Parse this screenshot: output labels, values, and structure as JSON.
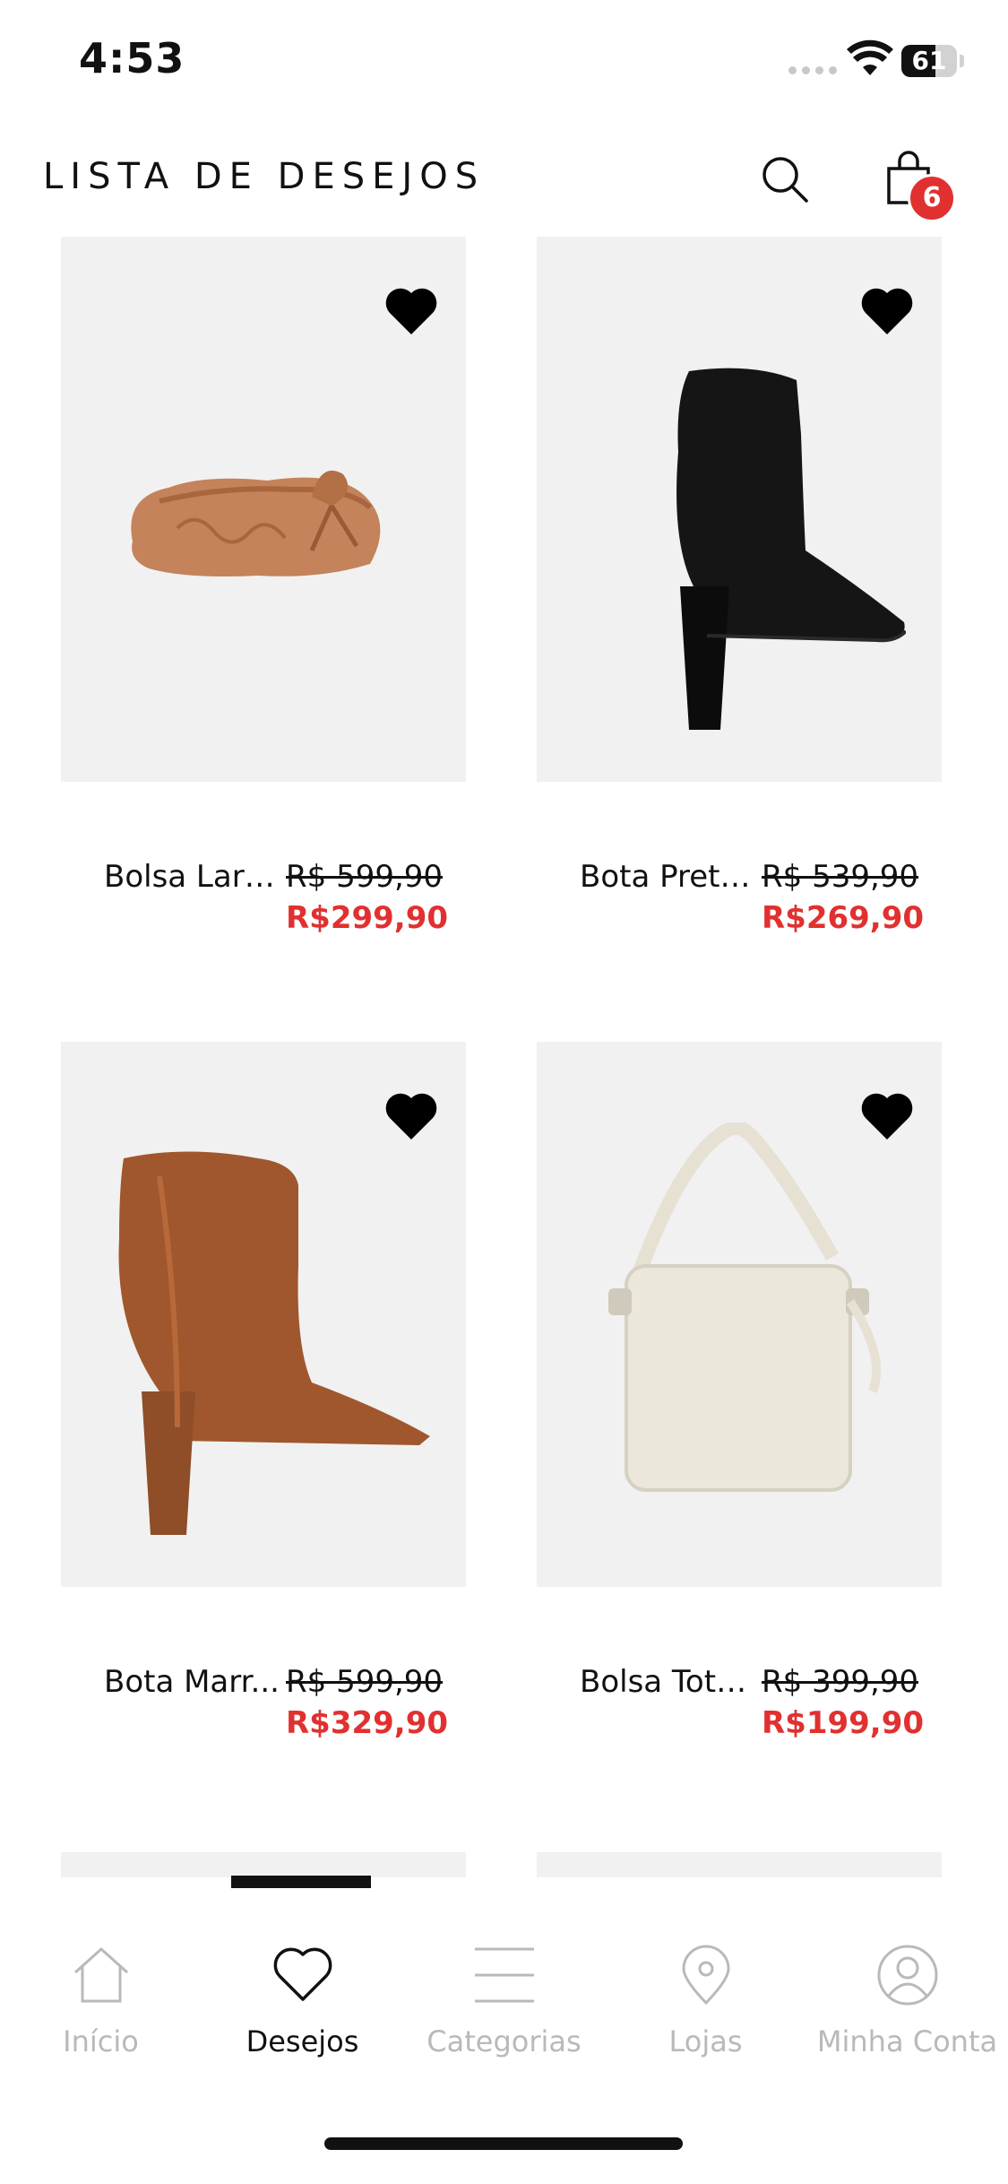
{
  "status": {
    "time": "4:53",
    "battery": "61",
    "battery_level": 0.61
  },
  "header": {
    "title": "LISTA DE DESEJOS",
    "cart_count": "6"
  },
  "products": [
    {
      "name": "Bolsa Lara...",
      "old_price": "R$ 599,90",
      "price": "R$299,90",
      "icon": "clutch-bag-image",
      "favorite": true
    },
    {
      "name": "Bota Preta...",
      "old_price": "R$ 539,90",
      "price": "R$269,90",
      "icon": "black-boot-image",
      "favorite": true
    },
    {
      "name": "Bota Marr...",
      "old_price": "R$ 599,90",
      "price": "R$329,90",
      "icon": "brown-boot-image",
      "favorite": true
    },
    {
      "name": "Bolsa Tote...",
      "old_price": "R$ 399,90",
      "price": "R$199,90",
      "icon": "tote-bag-image",
      "favorite": true
    }
  ],
  "tabs": [
    {
      "label": "Início",
      "icon": "home-icon"
    },
    {
      "label": "Desejos",
      "icon": "heart-icon",
      "active": true
    },
    {
      "label": "Categorias",
      "icon": "menu-icon"
    },
    {
      "label": "Lojas",
      "icon": "location-pin-icon"
    },
    {
      "label": "Minha Conta",
      "icon": "user-icon"
    }
  ],
  "colors": {
    "sale": "#e03130",
    "badge": "#e03130",
    "card_bg": "#f1f1f1",
    "inactive_tab": "#b9b9b9"
  }
}
